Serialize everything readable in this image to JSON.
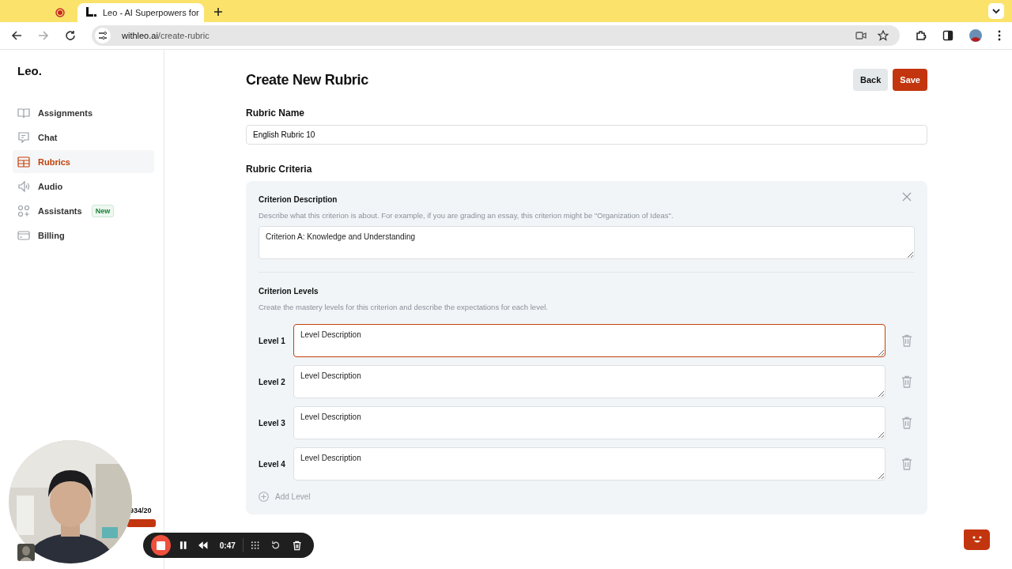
{
  "browser": {
    "tabs": [
      {
        "selected": false
      },
      {
        "title": "Leo - AI Superpowers for",
        "selected": true
      }
    ],
    "url_host": "withleo.ai",
    "url_path": "/create-rubric"
  },
  "sidebar": {
    "logo": "Leo.",
    "items": [
      {
        "label": "Assignments",
        "kind": "book",
        "selected": false
      },
      {
        "label": "Chat",
        "kind": "chat",
        "selected": false
      },
      {
        "label": "Rubrics",
        "kind": "table",
        "selected": true
      },
      {
        "label": "Audio",
        "kind": "audio",
        "selected": false
      },
      {
        "label": "Assistants",
        "kind": "apps",
        "selected": false,
        "badge": "New"
      },
      {
        "label": "Billing",
        "kind": "card",
        "selected": false
      }
    ],
    "usage": "934/20"
  },
  "page": {
    "title": "Create New Rubric",
    "buttons": [
      {
        "label": "Back",
        "kind": "secondary"
      },
      {
        "label": "Save",
        "kind": "primary"
      }
    ],
    "name_label": "Rubric Name",
    "name_value": "English Rubric 10",
    "criteria_label": "Rubric Criteria",
    "criterion": {
      "description_label": "Criterion Description",
      "description_help": "Describe what this criterion is about. For example, if you are grading an essay, this criterion might be \"Organization of Ideas\".",
      "description_value": "Criterion A: Knowledge and Understanding",
      "levels_label": "Criterion Levels",
      "levels_help": "Create the mastery levels for this criterion and describe the expectations for each level.",
      "levels": [
        {
          "label": "Level 1",
          "value": "Level Description",
          "focused": true
        },
        {
          "label": "Level 2",
          "value": "Level Description",
          "focused": false
        },
        {
          "label": "Level 3",
          "value": "Level Description",
          "focused": false
        },
        {
          "label": "Level 4",
          "value": "Level Description",
          "focused": false
        }
      ],
      "add_label": "Add Level"
    }
  },
  "recorder": {
    "time": "0:47"
  }
}
